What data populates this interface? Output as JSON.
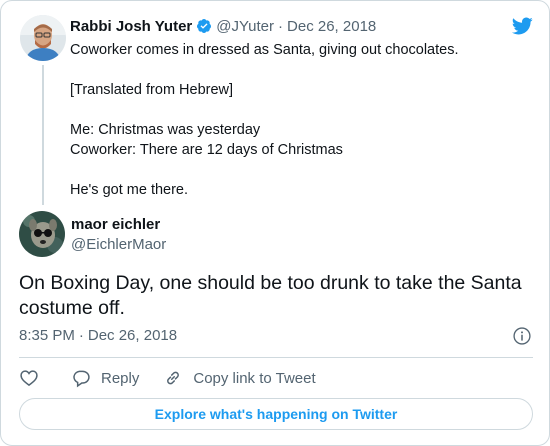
{
  "colors": {
    "accent": "#1d9bf0",
    "text": "#0f1419",
    "muted": "#536471",
    "border": "#cfd9de"
  },
  "parent_tweet": {
    "avatar_icon": "user-photo-avatar",
    "author_name": "Rabbi Josh Yuter",
    "verified_icon": "verified-badge-icon",
    "handle": "@JYuter",
    "separator": "·",
    "date": "Dec 26, 2018",
    "text": "Coworker comes in dressed as Santa, giving out chocolates.\n\n[Translated from Hebrew]\n\nMe: Christmas was yesterday\nCoworker: There are 12 days of Christmas\n\nHe's got me there."
  },
  "logo_icon": "twitter-bird-icon",
  "reply_tweet": {
    "avatar_icon": "dog-photo-avatar",
    "author_name": "maor eichler",
    "handle": "@EichlerMaor",
    "text": "On Boxing Day, one should be too drunk to take the Santa costume off.",
    "time": "8:35 PM",
    "separator": "·",
    "date": "Dec 26, 2018",
    "info_icon": "info-icon"
  },
  "actions": {
    "like_icon": "heart-icon",
    "reply_icon": "reply-bubble-icon",
    "reply_label": "Reply",
    "copy_icon": "link-icon",
    "copy_label": "Copy link to Tweet"
  },
  "explore_label": "Explore what's happening on Twitter"
}
